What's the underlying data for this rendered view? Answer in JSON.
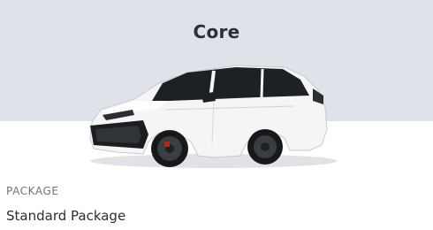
{
  "card": {
    "title": "Core",
    "hero_background": "#dee3e9",
    "image": "car-icon",
    "car_color": "#f4f4f4",
    "section_label": "PACKAGE",
    "section_value": "Standard Package"
  }
}
